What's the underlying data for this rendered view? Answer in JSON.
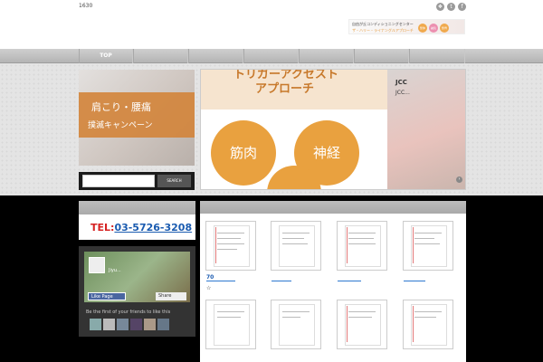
{
  "topbar": {
    "site_id": "1630"
  },
  "social": [
    {
      "icon": "rss-icon",
      "glyph": "❖"
    },
    {
      "icon": "twitter-icon",
      "glyph": "t"
    },
    {
      "icon": "facebook-icon",
      "glyph": "f"
    }
  ],
  "logo": {
    "line1": "自由が丘コンディショニングセンター",
    "line2": "ザ・ハリー・ライナングルアプローチ",
    "badges": [
      "整体",
      "鍼灸",
      "整骨"
    ]
  },
  "nav": {
    "items": [
      {
        "label": "TOP"
      }
    ]
  },
  "campaign": {
    "line1": "肩こり・腰痛",
    "line2": "撲滅キャンペーン"
  },
  "search": {
    "placeholder": "",
    "button_label": "SEARCH"
  },
  "slider": {
    "heading": "トリガーアクセスト",
    "heading2": "アプローチ",
    "circles": [
      "筋肉",
      "神経",
      ""
    ],
    "caption_title": "JCC",
    "caption_text": "JCC...",
    "next_arrow": "›"
  },
  "sidebar": {
    "tel_prefix": "TEL:",
    "tel_number": "03-5726-3208",
    "fb": {
      "page_name": "Jiyu...",
      "like_label": "Like Page",
      "share_label": "Share",
      "friends_text": "Be the first of your friends to like this"
    }
  },
  "content": {
    "items": [
      {
        "label": "70"
      },
      {
        "label": ""
      },
      {
        "label": ""
      },
      {
        "label": ""
      }
    ],
    "second_row_label": "☆"
  },
  "colors": {
    "accent_orange": "#e9a13f",
    "tel_red": "#d62222",
    "link_blue": "#1a5bb0",
    "fb_blue": "#4a66a0"
  }
}
